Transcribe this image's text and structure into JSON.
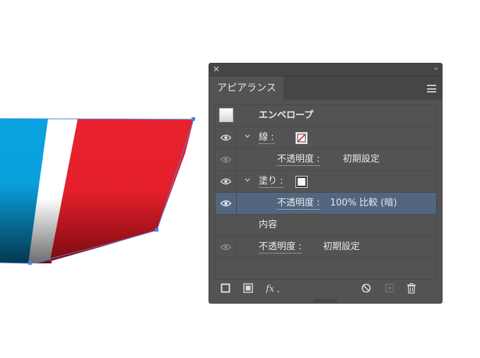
{
  "panel": {
    "tab_label": "アピアランス",
    "close_glyph": "✕",
    "collapse_glyph": "‹‹"
  },
  "rows": {
    "envelope": "エンベロープ",
    "stroke_label": "線 :",
    "opacity_label": "不透明度 :",
    "opacity_default": "初期設定",
    "fill_label": "塗り :",
    "fill_opacity_value": "100% 比較 (暗)",
    "contents": "内容",
    "content_opacity_label": "不透明度 :",
    "content_opacity_value": "初期設定"
  },
  "colors": {
    "blue": "#0aa3e0",
    "red": "#e8232e",
    "dark_red": "#8e0c14",
    "selection": "#52667f"
  },
  "icons": [
    "close-icon",
    "collapse-icon",
    "panel-menu-icon",
    "eye-icon",
    "chevron-down-icon",
    "add-stroke-icon",
    "add-fill-icon",
    "fx-icon",
    "clear-appearance-icon",
    "duplicate-item-icon",
    "delete-item-icon"
  ]
}
